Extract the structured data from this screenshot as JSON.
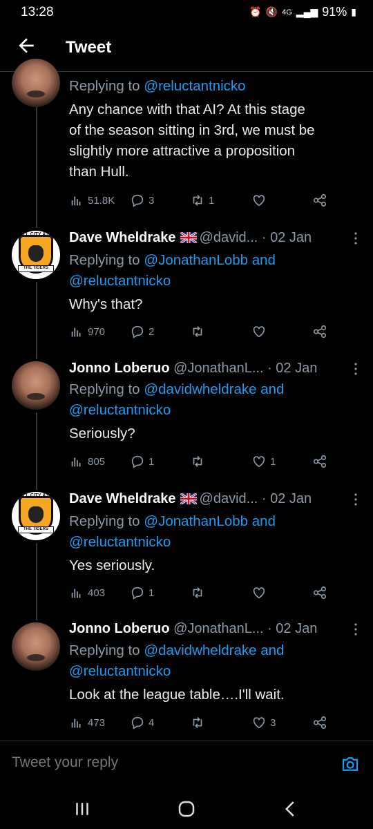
{
  "status_bar": {
    "time": "13:28",
    "network": "4G",
    "battery": "91%"
  },
  "header": {
    "title": "Tweet"
  },
  "replying_label": "Replying to",
  "tweets": [
    {
      "reply_mentions": [
        "@reluctantnicko"
      ],
      "text": [
        "Any chance with that AI?  At this stage",
        "of the season sitting in 3rd, we must be",
        "slightly more attractive a proposition",
        "than Hull."
      ],
      "views": "51.8K",
      "replies": "3",
      "retweets": "1",
      "likes": ""
    },
    {
      "name": "Dave Wheldrake",
      "handle": "@david...",
      "date": "· 02 Jan",
      "reply_mentions": [
        "@JonathanLobb and",
        "@reluctantnicko"
      ],
      "text": [
        "Why's that?"
      ],
      "views": "970",
      "replies": "2",
      "retweets": "",
      "likes": ""
    },
    {
      "name": "Jonno Loberuo",
      "handle": "@JonathanL...",
      "date": "· 02 Jan",
      "reply_mentions": [
        "@davidwheldrake and",
        "@reluctantnicko"
      ],
      "text": [
        "Seriously?"
      ],
      "views": "805",
      "replies": "1",
      "retweets": "",
      "likes": "1"
    },
    {
      "name": "Dave Wheldrake",
      "handle": "@david...",
      "date": "· 02 Jan",
      "reply_mentions": [
        "@JonathanLobb and",
        "@reluctantnicko"
      ],
      "text": [
        "Yes seriously."
      ],
      "views": "403",
      "replies": "1",
      "retweets": "",
      "likes": ""
    },
    {
      "name": "Jonno Loberuo",
      "handle": "@JonathanL...",
      "date": "· 02 Jan",
      "reply_mentions": [
        "@davidwheldrake and",
        "@reluctantnicko"
      ],
      "text": [
        "Look at the league table….I'll wait."
      ],
      "views": "473",
      "replies": "4",
      "retweets": "",
      "likes": "3"
    }
  ],
  "crest": {
    "top_text": "HULL CITY A.F.C.",
    "ribbon_text": "THE TIGERS"
  },
  "reply_box": {
    "placeholder": "Tweet your reply"
  },
  "colors": {
    "background": "#000000",
    "accent": "#1d9bf0",
    "muted": "#8b98a5"
  }
}
